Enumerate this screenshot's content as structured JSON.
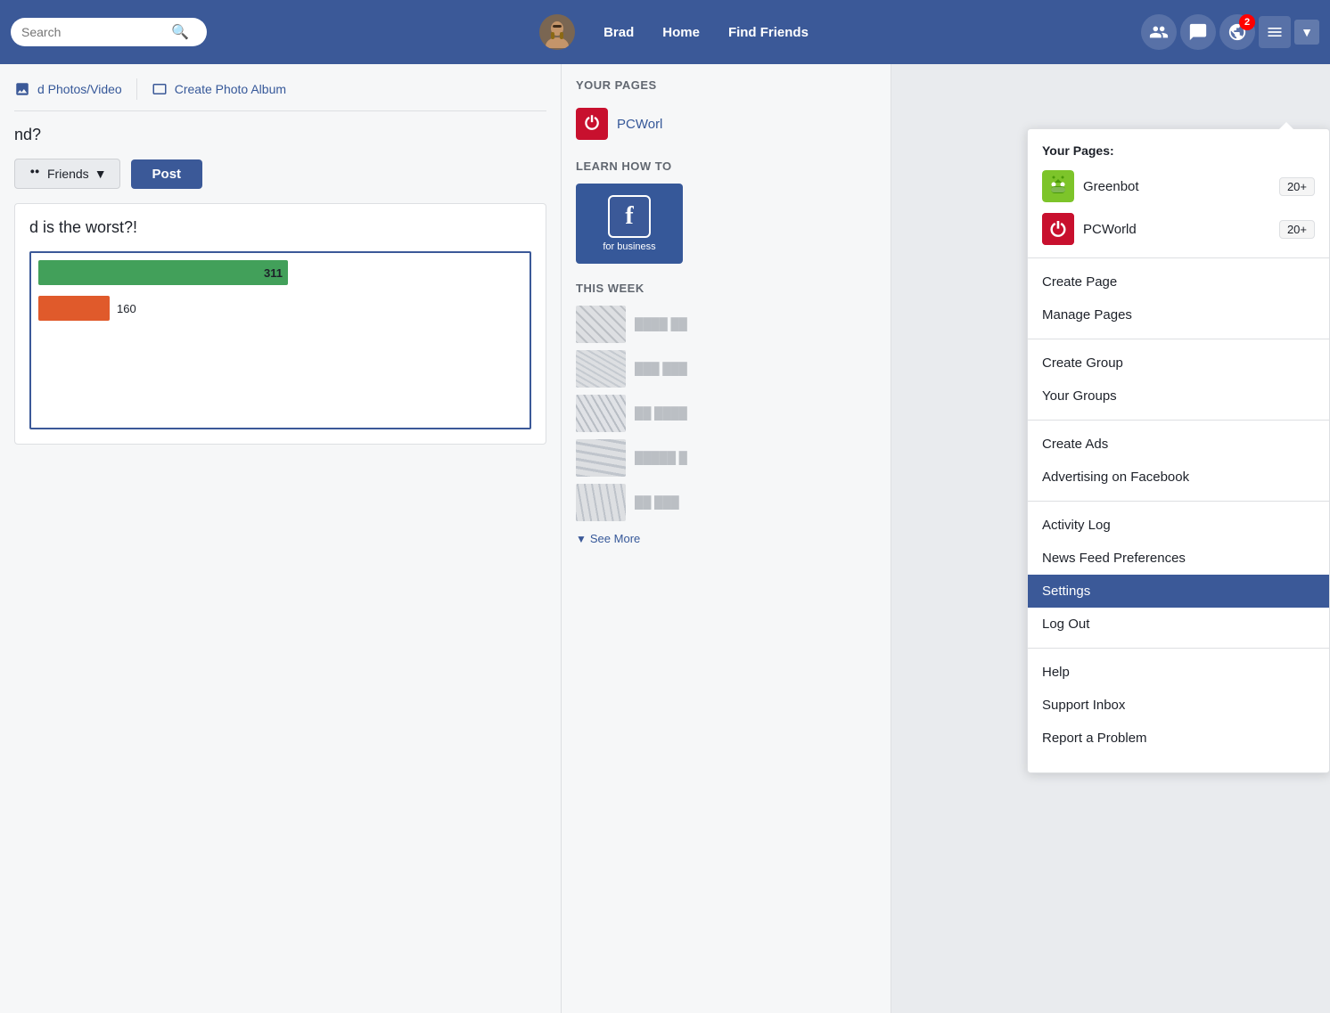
{
  "navbar": {
    "search_placeholder": "Search",
    "username": "Brad",
    "home_label": "Home",
    "find_friends_label": "Find Friends",
    "notification_count": "2"
  },
  "action_bar": {
    "add_photos_label": "d Photos/Video",
    "create_album_label": "Create Photo Album"
  },
  "post_area": {
    "question": "nd?",
    "friends_btn": "Friends",
    "post_btn": "Post"
  },
  "chart": {
    "title": "d is the worst?!",
    "bar1_value": "311",
    "bar2_value": "160"
  },
  "center_panel": {
    "pages_title": "YOUR PAGES",
    "page1_name": "PCWorl",
    "learn_title": "Learn How to",
    "for_business": "for business",
    "this_week_title": "This Week",
    "see_more": "See More"
  },
  "dropdown": {
    "your_pages_label": "Your Pages:",
    "page1_name": "Greenbot",
    "page1_badge": "20+",
    "page2_name": "PCWorld",
    "page2_badge": "20+",
    "create_page": "Create Page",
    "manage_pages": "Manage Pages",
    "create_group": "Create Group",
    "your_groups": "Your Groups",
    "create_ads": "Create Ads",
    "advertising_on_facebook": "Advertising on Facebook",
    "activity_log": "Activity Log",
    "news_feed_preferences": "News Feed Preferences",
    "settings": "Settings",
    "log_out": "Log Out",
    "help": "Help",
    "support_inbox": "Support Inbox",
    "report_a_problem": "Report a Problem"
  }
}
